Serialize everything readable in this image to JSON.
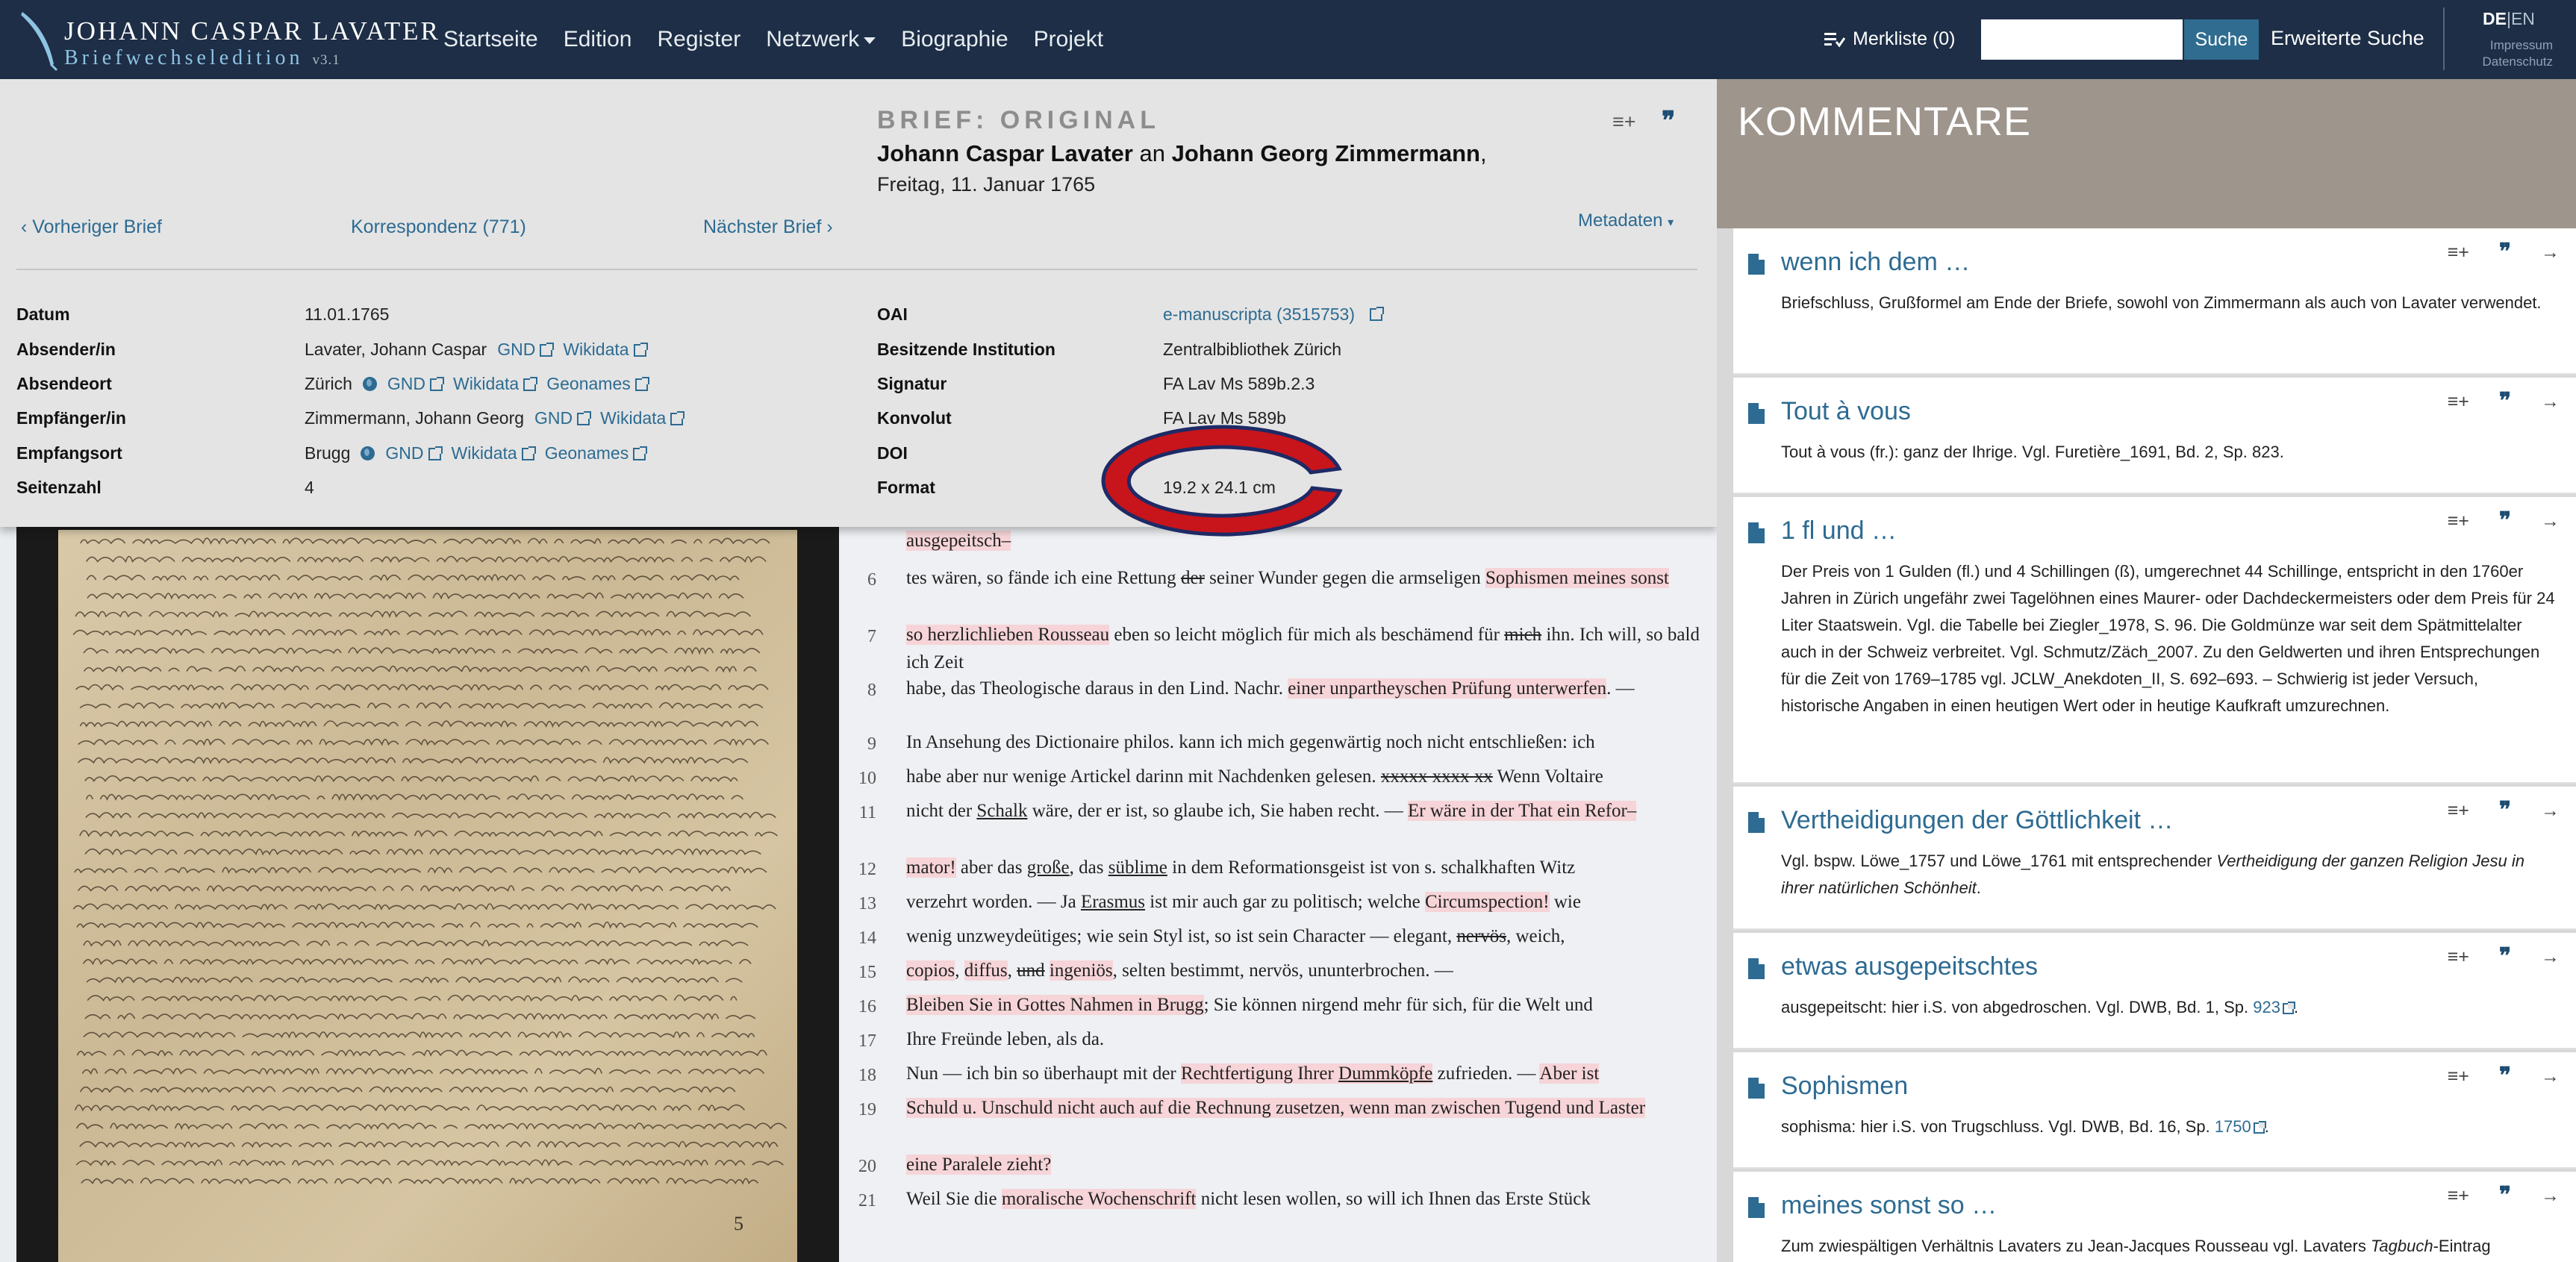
{
  "brand": {
    "name": "JOHANN CASPAR LAVATER",
    "subtitle": "Briefwechseledition",
    "version": "v3.1"
  },
  "nav": {
    "items": [
      "Startseite",
      "Edition",
      "Register",
      "Netzwerk",
      "Biographie",
      "Projekt"
    ],
    "merkliste": "Merkliste (0)",
    "search_placeholder": "",
    "search_button": "Suche",
    "advanced_search": "Erweiterte Suche",
    "lang_de": "DE",
    "lang_sep": "|",
    "lang_en": "EN",
    "impressum": "Impressum",
    "datenschutz": "Datenschutz"
  },
  "letter": {
    "label": "BRIEF: ORIGINAL",
    "sender": "Johann Caspar Lavater",
    "connector": "an",
    "recipient": "Johann Georg Zimmermann",
    "trail": ",",
    "date": "Freitag, 11. Januar 1765",
    "prev": "Vorheriger Brief",
    "korrespondenz": "Korrespondenz (771)",
    "next": "Nächster Brief",
    "metadata_toggle": "Metadaten"
  },
  "metadata_left": [
    {
      "key": "Datum",
      "value": "11.01.1765",
      "links": []
    },
    {
      "key": "Absender/in",
      "value": "Lavater, Johann Caspar",
      "links": [
        "GND",
        "Wikidata"
      ]
    },
    {
      "key": "Absendeort",
      "value": "Zürich",
      "globe": true,
      "links": [
        "GND",
        "Wikidata",
        "Geonames"
      ]
    },
    {
      "key": "Empfänger/in",
      "value": "Zimmermann, Johann Georg",
      "links": [
        "GND",
        "Wikidata"
      ]
    },
    {
      "key": "Empfangsort",
      "value": "Brugg",
      "globe": true,
      "links": [
        "GND",
        "Wikidata",
        "Geonames"
      ]
    },
    {
      "key": "Seitenzahl",
      "value": "4",
      "links": []
    }
  ],
  "metadata_right": [
    {
      "key": "OAI",
      "value": "e-manuscripta (3515753)",
      "link": true
    },
    {
      "key": "Besitzende Institution",
      "value": "Zentralbibliothek Zürich"
    },
    {
      "key": "Signatur",
      "value": "FA Lav Ms 589b.2.3"
    },
    {
      "key": "Konvolut",
      "value": "FA Lav Ms 589b"
    },
    {
      "key": "DOI",
      "value": ""
    },
    {
      "key": "Format",
      "value": "19.2 x 24.1 cm"
    }
  ],
  "manuscript": {
    "page_number": "5"
  },
  "transcription": [
    {
      "n": "",
      "segments": [
        {
          "t": "ausgepeitsch–",
          "hl": true
        }
      ]
    },
    {
      "n": "6",
      "segments": [
        {
          "t": "tes wären, so fände ich eine Rettung "
        },
        {
          "t": "der",
          "strike": true
        },
        {
          "t": " seiner Wunder gegen die armseligen "
        },
        {
          "t": "Sophismen meines sonst",
          "hl": true
        }
      ]
    },
    {
      "n": "7",
      "segments": [
        {
          "t": "so herzlichlieben Rousseau",
          "hl": true
        },
        {
          "t": " eben so leicht möglich für mich als beschämend für "
        },
        {
          "t": "mich",
          "strike": true
        },
        {
          "t": " ihn. Ich will, so bald ich Zeit"
        }
      ]
    },
    {
      "n": "8",
      "segments": [
        {
          "t": "habe, das Theologische daraus in den Lind. Nachr. "
        },
        {
          "t": "einer unpartheyschen Prüfung unterwerfen",
          "hl": true
        },
        {
          "t": ". —"
        }
      ]
    },
    {
      "n": "9",
      "segments": [
        {
          "t": "In Ansehung des Dictionaire philos. kann ich mich gegenwärtig noch nicht entschließen: ich"
        }
      ]
    },
    {
      "n": "10",
      "segments": [
        {
          "t": "habe aber nur wenige Artickel darinn mit Nachdenken gelesen. "
        },
        {
          "t": "xxxxx xxxx xx",
          "strike": true
        },
        {
          "t": " Wenn Voltaire"
        }
      ]
    },
    {
      "n": "11",
      "segments": [
        {
          "t": "nicht der "
        },
        {
          "t": "Schalk",
          "ul": true
        },
        {
          "t": " wäre, der er ist, so glaube ich, Sie haben recht. — "
        },
        {
          "t": "Er wäre in der That ein Refor–",
          "hl": true
        }
      ]
    },
    {
      "n": "12",
      "segments": [
        {
          "t": "mator!",
          "hl": true
        },
        {
          "t": " aber das "
        },
        {
          "t": "große",
          "ul": true
        },
        {
          "t": ", das "
        },
        {
          "t": "süblime",
          "ul": true
        },
        {
          "t": " in dem Reformationsgeist ist von s. schalkhaften Witz"
        }
      ]
    },
    {
      "n": "13",
      "segments": [
        {
          "t": "verzehrt worden. — Ja "
        },
        {
          "t": "Erasmus",
          "ul": true
        },
        {
          "t": " ist mir auch gar zu politisch; welche "
        },
        {
          "t": "Circumspection!",
          "hl": true
        },
        {
          "t": " wie"
        }
      ]
    },
    {
      "n": "14",
      "segments": [
        {
          "t": "wenig unzweydeütiges; wie sein Styl ist, so ist sein Character — elegant, "
        },
        {
          "t": "nervös",
          "strike": true
        },
        {
          "t": ", weich,"
        }
      ]
    },
    {
      "n": "15",
      "segments": [
        {
          "t": "copios",
          "hl": true
        },
        {
          "t": ", "
        },
        {
          "t": "diffus",
          "hl": true
        },
        {
          "t": ", "
        },
        {
          "t": "und",
          "strike": true
        },
        {
          "t": " "
        },
        {
          "t": "ingeniös",
          "hl": true
        },
        {
          "t": ", selten bestimmt, nervös, ununterbrochen. —"
        }
      ]
    },
    {
      "n": "16",
      "segments": [
        {
          "t": "Bleiben Sie in Gottes Nahmen in Brugg",
          "hl": true
        },
        {
          "t": "; Sie können nirgend mehr für sich, für die Welt und"
        }
      ]
    },
    {
      "n": "17",
      "segments": [
        {
          "t": "Ihre Freünde leben, als da."
        }
      ]
    },
    {
      "n": "18",
      "segments": [
        {
          "t": "Nun — ich bin so überhaupt mit der "
        },
        {
          "t": "Rechtfertigung Ihrer ",
          "hl": true
        },
        {
          "t": "Dummköpfe",
          "hl": true,
          "ul": true
        },
        {
          "t": " zufrieden. — "
        },
        {
          "t": "Aber ist",
          "hl": true
        }
      ]
    },
    {
      "n": "19",
      "segments": [
        {
          "t": "Schuld u. Unschuld nicht auch auf die Rechnung zusetzen, wenn man zwischen Tugend und Laster",
          "hl": true
        }
      ]
    },
    {
      "n": "20",
      "segments": [
        {
          "t": "eine Paralele zieht?",
          "hl": true
        }
      ]
    },
    {
      "n": "21",
      "segments": [
        {
          "t": "Weil Sie die "
        },
        {
          "t": "moralische Wochenschrift",
          "hl": true
        },
        {
          "t": " nicht lesen wollen, so will ich Ihnen das Erste Stück"
        }
      ]
    }
  ],
  "comments": {
    "header": "KOMMENTARE",
    "items": [
      {
        "title": "wenn ich dem …",
        "body": "Briefschluss, Grußformel am Ende der Briefe, sowohl von Zimmermann als auch von Lavater verwendet."
      },
      {
        "title": "Tout à vous",
        "body": "Tout à vous (fr.): ganz der Ihrige. Vgl. Furetière_1691, Bd. 2, Sp. 823."
      },
      {
        "title": "1 fl und …",
        "body": "Der Preis von 1 Gulden (fl.) und 4 Schillingen (ß), umgerechnet 44 Schillinge, entspricht in den 1760er Jahren in Zürich ungefähr zwei Tagelöhnen eines Maurer- oder Dachdeckermeisters oder dem Preis für 24 Liter Staatswein. Vgl. die Tabelle bei Ziegler_1978, S. 96. Die Goldmünze war seit dem Spätmittelalter auch in der Schweiz verbreitet. Vgl. Schmutz/Zäch_2007. Zu den Geldwerten und ihren Entsprechungen für die Zeit von 1769–1785 vgl. JCLW_Anekdoten_II, S. 692–693. – Schwierig ist jeder Versuch, historische Angaben in einen heutigen Wert oder in heutige Kaufkraft umzurechnen."
      },
      {
        "title": "Vertheidigungen der Göttlichkeit …",
        "body_plain": "Vgl. bspw. Löwe_1757 und Löwe_1761 mit entsprechender ",
        "body_italic": "Vertheidigung der ganzen Religion Jesu in ihrer natürlichen Schönheit",
        "body_end": "."
      },
      {
        "title": "etwas ausgepeitschtes",
        "body": "ausgepeitscht: hier i.S. von abgedroschen. Vgl. DWB, Bd. 1, Sp. ",
        "link": "923",
        "body_end": "."
      },
      {
        "title": "Sophismen",
        "body": "sophisma: hier i.S. von Trugschluss. Vgl. DWB, Bd. 16, Sp. ",
        "link": "1750",
        "body_end": "."
      },
      {
        "title": "meines sonst so …",
        "body_plain": "Zum zwiespältigen Verhältnis Lavaters zu Jean-Jacques Rousseau vgl. Lavaters ",
        "body_italic": "Tagbuch",
        "body_end": "-Eintrag"
      }
    ]
  },
  "colors": {
    "navbar": "#1d2e46",
    "link": "#2d6b92",
    "highlight": "#f6d4d8",
    "comments_header": "#9e958c",
    "annotation_ring": "#c8141b"
  }
}
